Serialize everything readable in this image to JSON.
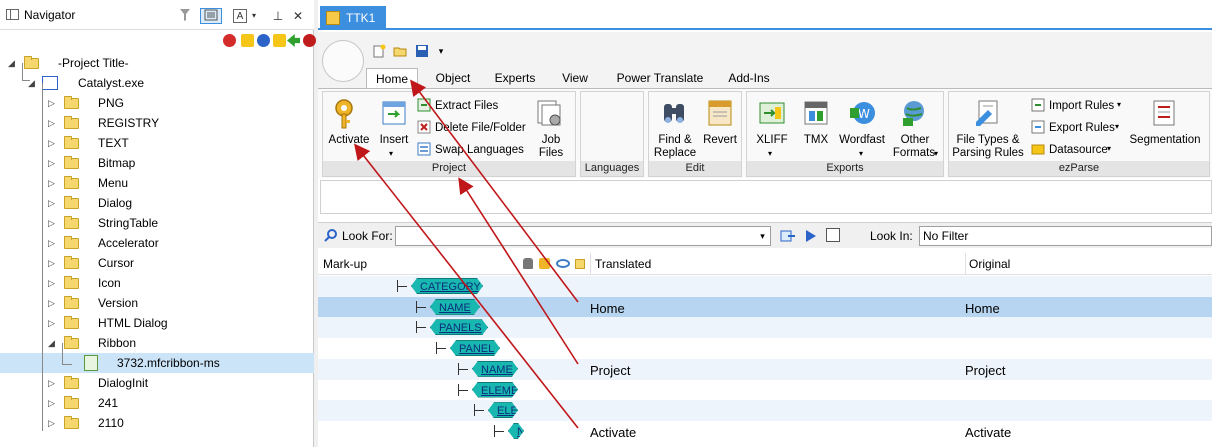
{
  "navigator": {
    "title": "Navigator",
    "toolbar_letter": "A",
    "pin": "⊥",
    "close": "✕",
    "tree": [
      {
        "label": "-Project Title-",
        "level": 0
      },
      {
        "label": "Catalyst.exe",
        "level": 1
      },
      {
        "label": "PNG",
        "level": 2
      },
      {
        "label": "REGISTRY",
        "level": 2
      },
      {
        "label": "TEXT",
        "level": 2
      },
      {
        "label": "Bitmap",
        "level": 2
      },
      {
        "label": "Menu",
        "level": 2
      },
      {
        "label": "Dialog",
        "level": 2
      },
      {
        "label": "StringTable",
        "level": 2
      },
      {
        "label": "Accelerator",
        "level": 2
      },
      {
        "label": "Cursor",
        "level": 2
      },
      {
        "label": "Icon",
        "level": 2
      },
      {
        "label": "Version",
        "level": 2
      },
      {
        "label": "HTML Dialog",
        "level": 2
      },
      {
        "label": "Ribbon",
        "level": 2
      },
      {
        "label": "3732.mfcribbon-ms",
        "level": 3
      },
      {
        "label": "DialogInit",
        "level": 2
      },
      {
        "label": "241",
        "level": 2
      },
      {
        "label": "2110",
        "level": 2
      }
    ]
  },
  "doc_tab": {
    "label": "TTK1"
  },
  "ribbon": {
    "tabs": [
      "Home",
      "Object",
      "Experts",
      "View",
      "Power Translate",
      "Add-Ins"
    ],
    "active_tab": "Home",
    "groups": {
      "project": {
        "label": "Project",
        "activate": "Activate",
        "insert": "Insert",
        "extract_files": "Extract Files",
        "delete_file": "Delete File/Folder",
        "swap_languages": "Swap Languages",
        "job_files_1": "Job",
        "job_files_2": "Files"
      },
      "languages": {
        "label": "Languages"
      },
      "edit": {
        "label": "Edit",
        "find_1": "Find &",
        "find_2": "Replace",
        "revert": "Revert"
      },
      "exports": {
        "label": "Exports",
        "xliff": "XLIFF",
        "tmx": "TMX",
        "wordfast": "Wordfast",
        "other_1": "Other",
        "other_2": "Formats"
      },
      "ezparse": {
        "label": "ezParse",
        "filetypes_1": "File Types &",
        "filetypes_2": "Parsing Rules",
        "import_rules": "Import Rules",
        "export_rules": "Export Rules",
        "datasource": "Datasource",
        "segmentation": "Segmentation"
      }
    }
  },
  "search": {
    "look_for_label": "Look For:",
    "look_for_value": "",
    "look_in_label": "Look In:",
    "look_in_value": "No Filter"
  },
  "grid": {
    "columns": {
      "markup": "Mark-up",
      "translated": "Translated",
      "original": "Original"
    },
    "rows": [
      {
        "tag": "CATEGORY",
        "depth": 0,
        "translated": "",
        "original": ""
      },
      {
        "tag": "NAME",
        "depth": 1,
        "translated": "Home",
        "original": "Home"
      },
      {
        "tag": "PANELS",
        "depth": 1,
        "translated": "",
        "original": ""
      },
      {
        "tag": "PANEL",
        "depth": 2,
        "translated": "",
        "original": ""
      },
      {
        "tag": "NAME",
        "depth": 3,
        "translated": "Project",
        "original": "Project"
      },
      {
        "tag": "ELEMENTS",
        "depth": 3,
        "translated": "",
        "original": ""
      },
      {
        "tag": "ELEMENT",
        "depth": 4,
        "translated": "",
        "original": ""
      },
      {
        "tag": "NAME",
        "depth": 5,
        "translated": "Activate",
        "original": "Activate"
      }
    ]
  },
  "colors": {
    "accent": "#3c8ede",
    "tag": "#18b7b0",
    "arrow": "#c0171b",
    "selected_row": "#b7d5f0"
  }
}
